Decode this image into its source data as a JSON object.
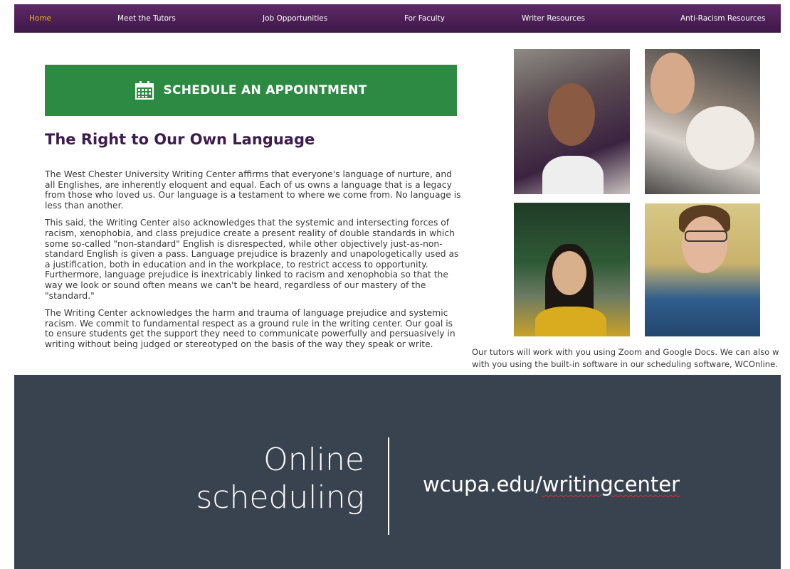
{
  "nav": {
    "items": [
      {
        "label": "Home",
        "active": true
      },
      {
        "label": "Meet the Tutors",
        "active": false
      },
      {
        "label": "Job Opportunities",
        "active": false
      },
      {
        "label": "For Faculty",
        "active": false
      },
      {
        "label": "Writer Resources",
        "active": false
      },
      {
        "label": "Anti-Racism Resources",
        "active": false
      }
    ]
  },
  "schedule_button": {
    "label": "SCHEDULE AN APPOINTMENT",
    "icon": "calendar-icon"
  },
  "article": {
    "heading": "The Right to Our Own Language",
    "paragraphs": [
      "The West Chester University Writing Center affirms that everyone's language of nurture, and all Englishes, are inherently eloquent and equal. Each of us owns a language that is a legacy from those who loved us. Our language is a testament to where we come from. No language is less than another.",
      "This said, the Writing Center also acknowledges that the systemic and intersecting forces of racism, xenophobia, and class prejudice create a present reality of double standards in which some so-called \"non-standard\" English is disrespected, while other objectively just-as-non-standard English is given a pass. Language prejudice is brazenly and unapologetically used as a justification, both in education and in the workplace, to restrict access to opportunity. Furthermore, language prejudice is inextricably linked to racism and xenophobia so that the way we look or sound often means we can't be heard, regardless of our mastery of the \"standard.\"",
      "The Writing Center acknowledges the harm and trauma of language prejudice and systemic racism. We commit to fundamental respect as a ground rule in the writing center. Our goal is to ensure students get the support they need to communicate powerfully and persuasively in writing without being judged or stereotyped on the basis of the way they speak or write."
    ]
  },
  "tutors_caption": {
    "line1": "Our tutors will work with you using Zoom and Google Docs. We can also w",
    "line2": "with you using the built-in software in our scheduling software, WCOnline."
  },
  "banner": {
    "title_line1": "Online",
    "title_line2": "scheduling",
    "url_prefix": "wcupa.edu/",
    "url_suffix": "writingcenter"
  },
  "colors": {
    "nav_bg": "#4a1f55",
    "nav_active": "#f0b323",
    "button_green": "#2d8a42",
    "heading_purple": "#3d1c4e",
    "banner_bg": "#39434f"
  }
}
